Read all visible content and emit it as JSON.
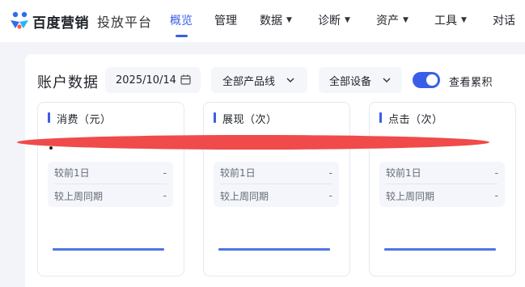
{
  "header": {
    "brand": "百度营销",
    "subtitle": "投放平台",
    "nav": [
      {
        "label": "概览",
        "active": true,
        "dropdown": false,
        "icon": ""
      },
      {
        "label": "管理",
        "active": false,
        "dropdown": false,
        "icon": ""
      },
      {
        "label": "数据",
        "active": false,
        "dropdown": true,
        "icon": "caret-down-icon"
      },
      {
        "label": "诊断",
        "active": false,
        "dropdown": true,
        "icon": "caret-down-icon"
      },
      {
        "label": "资产",
        "active": false,
        "dropdown": true,
        "icon": "caret-down-icon"
      },
      {
        "label": "工具",
        "active": false,
        "dropdown": true,
        "icon": "caret-down-icon"
      },
      {
        "label": "对话",
        "active": false,
        "dropdown": false,
        "icon": ""
      }
    ]
  },
  "account": {
    "title": "账户数据",
    "date": "2025/10/14",
    "date_icon": "calendar-icon",
    "product_line": "全部产品线",
    "device": "全部设备",
    "cumulative_toggle": {
      "label": "查看累积",
      "on": true
    }
  },
  "metrics": [
    {
      "title": "消费（元）",
      "compare": [
        {
          "label": "较前1日",
          "value": "-"
        },
        {
          "label": "较上周同期",
          "value": "-"
        }
      ]
    },
    {
      "title": "展现（次）",
      "compare": [
        {
          "label": "较前1日",
          "value": "-"
        },
        {
          "label": "较上周同期",
          "value": "-"
        }
      ]
    },
    {
      "title": "点击（次）",
      "compare": [
        {
          "label": "较前1日",
          "value": "-"
        },
        {
          "label": "较上周同期",
          "value": "-"
        }
      ]
    }
  ],
  "colors": {
    "accent": "#3a5ee8",
    "scribble": "#f04a4a",
    "background": "#f2f4f9"
  }
}
